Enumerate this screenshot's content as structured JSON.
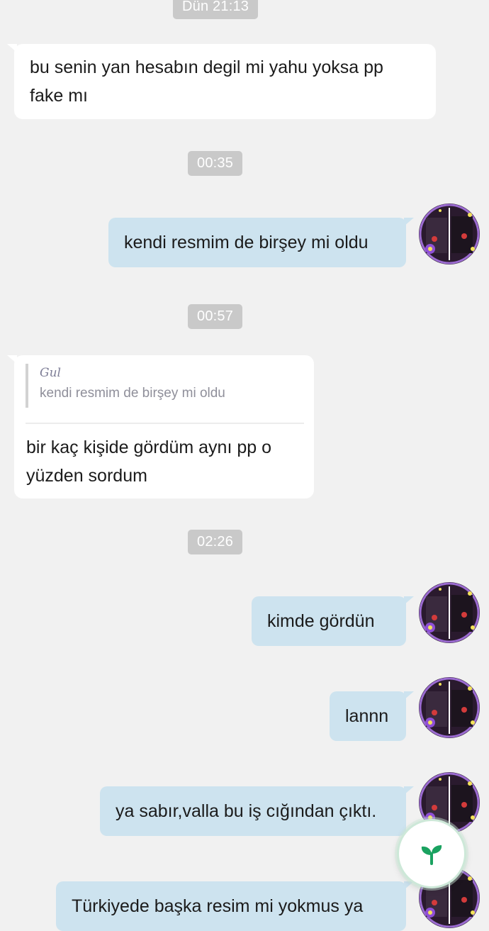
{
  "chat": {
    "timestamps": {
      "t1": "Dün 21:13",
      "t2": "00:35",
      "t3": "00:57",
      "t4": "02:26"
    },
    "messages": {
      "m1": "bu senin yan hesabın degil mi yahu yoksa pp fake mı",
      "m2": "kendi resmim de birşey mi oldu",
      "m3": {
        "quote_author": "Gul",
        "quote_text": "kendi resmim de birşey mi oldu",
        "text": "bir kaç kişide gördüm aynı pp o yüzden sordum"
      },
      "m4": "kimde gördün",
      "m5": "lannn",
      "m6": "ya sabır,valla bu iş cığından çıktı.",
      "m7": "Türkiyede başka resim mi yokmus ya"
    }
  },
  "fab": {
    "icon": "sprout-icon",
    "color": "#1aa260"
  },
  "colors": {
    "background": "#f1f1f1",
    "sent_bubble": "#cde3ef",
    "received_bubble": "#ffffff",
    "timestamp_bg": "#c9c9c9"
  }
}
